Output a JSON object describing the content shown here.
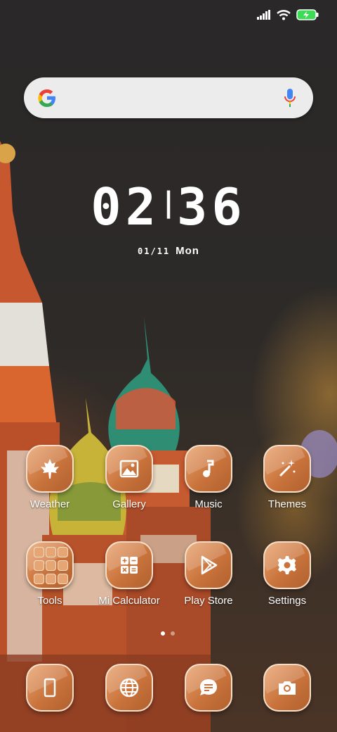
{
  "clock": {
    "time_h": "02",
    "time_m": "36",
    "date": "01/11",
    "weekday": "Mon"
  },
  "apps": [
    {
      "label": "Weather",
      "icon": "maple-leaf-icon"
    },
    {
      "label": "Gallery",
      "icon": "image-icon"
    },
    {
      "label": "Music",
      "icon": "music-note-icon"
    },
    {
      "label": "Themes",
      "icon": "magic-wand-icon"
    },
    {
      "label": "Tools",
      "icon": "folder-icon"
    },
    {
      "label": "Mi Calculator",
      "icon": "calculator-icon"
    },
    {
      "label": "Play Store",
      "icon": "play-store-icon"
    },
    {
      "label": "Settings",
      "icon": "gear-icon"
    }
  ],
  "dock": [
    {
      "icon": "phone-icon"
    },
    {
      "icon": "browser-globe-icon"
    },
    {
      "icon": "messages-icon"
    },
    {
      "icon": "camera-icon"
    }
  ],
  "colors": {
    "icon_accent": "#c9733c",
    "battery": "#3ddc57"
  }
}
